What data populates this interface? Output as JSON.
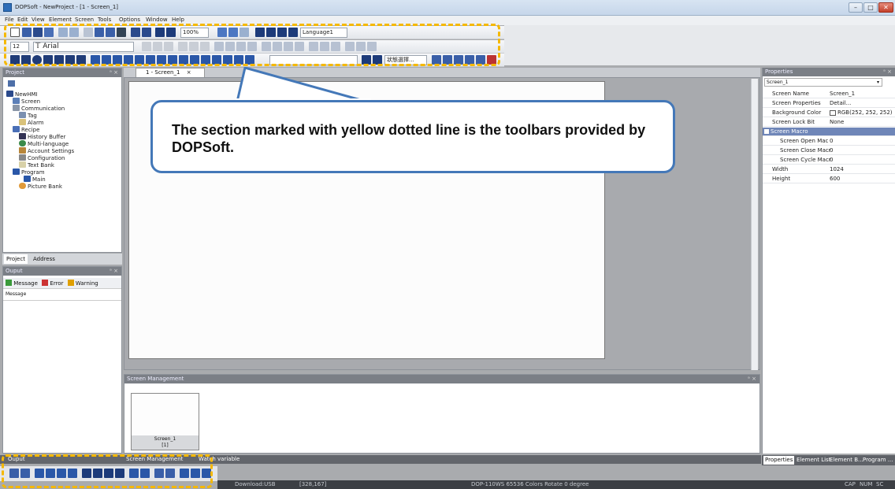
{
  "window": {
    "title": "DOPSoft - NewProject - [1 - Screen_1]"
  },
  "menu": [
    "File",
    "Edit",
    "View",
    "Element",
    "Screen",
    "Tools",
    "Options",
    "Window",
    "Help"
  ],
  "toolbar": {
    "zoom": "100%",
    "language": "Language1",
    "font_size": "12",
    "font_name": "Arial",
    "state_select": "狀態選擇..."
  },
  "project_panel": {
    "title": "Project",
    "tree": [
      "NewHMI",
      "Screen",
      "Communication",
      "Tag",
      "Alarm",
      "Recipe",
      "History Buffer",
      "Multi-language",
      "Account Settings",
      "Configuration",
      "Text Bank",
      "Program",
      "Main",
      "Picture Bank"
    ],
    "tabs": [
      "Project",
      "Address"
    ]
  },
  "output_panel": {
    "title": "Ouput",
    "filters": [
      "Message",
      "Error",
      "Warning"
    ],
    "column": "Message"
  },
  "document": {
    "tab": "1 - Screen_1"
  },
  "screen_management": {
    "title": "Screen Management",
    "thumb_name": "Screen_1",
    "thumb_id": "[1]"
  },
  "properties": {
    "title": "Properties",
    "selected": "Screen_1",
    "rows": [
      {
        "name": "Screen Name",
        "value": "Screen_1"
      },
      {
        "name": "Screen Properties",
        "value": "Detail..."
      },
      {
        "name": "Background Color",
        "value": "RGB(252, 252, 252)"
      },
      {
        "name": "Screen Lock Bit",
        "value": "None"
      },
      {
        "name": "Screen Macro",
        "value": ""
      },
      {
        "name": "Screen Open Mac",
        "value": "0"
      },
      {
        "name": "Screen Close Macr",
        "value": "0"
      },
      {
        "name": "Screen Cycle Macr",
        "value": "0"
      },
      {
        "name": "Width",
        "value": "1024"
      },
      {
        "name": "Height",
        "value": "600"
      }
    ],
    "tabs": [
      "Properties",
      "Element List",
      "Element B...",
      "Program ..."
    ]
  },
  "callout": {
    "text": "The section marked with yellow dotted line is the toolbars provided by DOPSoft."
  },
  "bottom_tabs": [
    "Ouput",
    "Screen Management",
    "Watch variable"
  ],
  "status": {
    "download": "Download:USB",
    "coords": "[328,167]",
    "device": "DOP-110WS 65536 Colors Rotate 0 degree",
    "indicators": [
      "CAP",
      "NUM",
      "SC"
    ]
  },
  "colors": {
    "accent": "#4478b8",
    "highlight": "#f5b800"
  }
}
